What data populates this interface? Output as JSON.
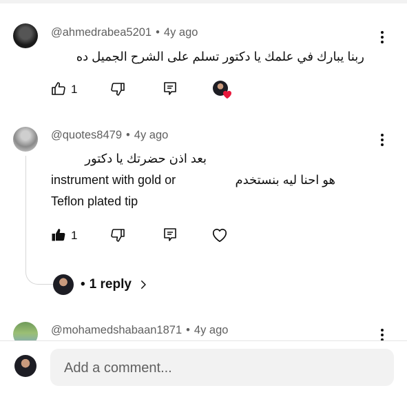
{
  "comments": [
    {
      "author": "@ahmedrabea5201",
      "age": "4y ago",
      "lines": [
        "ربنا يبارك في علمك يا دكتور تسلم على الشرح الجميل ده"
      ],
      "likes": "1",
      "liked": false,
      "creator_hearted": true
    },
    {
      "author": "@quotes8479",
      "age": "4y ago",
      "lines": [
        "بعد اذن حضرتك يا دكتور",
        "instrument with gold or",
        "هو احنا ليه بنستخدم",
        "Teflon plated tip"
      ],
      "likes": "1",
      "liked": true,
      "creator_hearted": false,
      "replies_label": "1 reply"
    },
    {
      "author": "@mohamedshabaan1871",
      "age": "4y ago"
    }
  ],
  "composer": {
    "placeholder": "Add a comment..."
  },
  "separator": "•",
  "icons": {
    "like": "thumbs-up-icon",
    "dislike": "thumbs-down-icon",
    "reply": "reply-icon",
    "heart": "heart-icon",
    "more": "more-vert-icon",
    "chevron": "chevron-right-icon"
  },
  "colors": {
    "text": "#0f0f0f",
    "meta": "#606060",
    "heart": "#e8193c",
    "input_bg": "#f2f2f2"
  }
}
